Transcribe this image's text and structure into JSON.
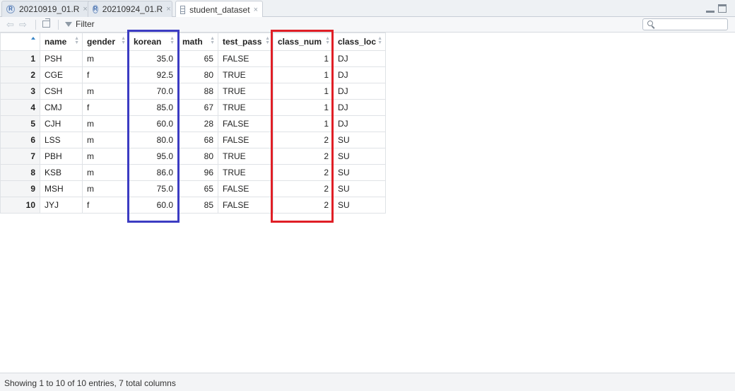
{
  "tabs": [
    {
      "label": "20210919_01.R",
      "type": "r-script",
      "close": "×"
    },
    {
      "label": "20210924_01.R",
      "type": "r-script",
      "close": "×"
    },
    {
      "label": "student_dataset",
      "type": "data",
      "close": "×"
    }
  ],
  "toolbar": {
    "back": "⇦",
    "forward": "⇨",
    "filter_label": "Filter",
    "search_value": "",
    "search_placeholder": ""
  },
  "table": {
    "columns": [
      "name",
      "gender",
      "korean",
      "math",
      "test_pass",
      "class_num",
      "class_loc"
    ],
    "rows": [
      {
        "n": "1",
        "cells": [
          "PSH",
          "m",
          "35.0",
          "65",
          "FALSE",
          "1",
          "DJ"
        ]
      },
      {
        "n": "2",
        "cells": [
          "CGE",
          "f",
          "92.5",
          "80",
          "TRUE",
          "1",
          "DJ"
        ]
      },
      {
        "n": "3",
        "cells": [
          "CSH",
          "m",
          "70.0",
          "88",
          "TRUE",
          "1",
          "DJ"
        ]
      },
      {
        "n": "4",
        "cells": [
          "CMJ",
          "f",
          "85.0",
          "67",
          "TRUE",
          "1",
          "DJ"
        ]
      },
      {
        "n": "5",
        "cells": [
          "CJH",
          "m",
          "60.0",
          "28",
          "FALSE",
          "1",
          "DJ"
        ]
      },
      {
        "n": "6",
        "cells": [
          "LSS",
          "m",
          "80.0",
          "68",
          "FALSE",
          "2",
          "SU"
        ]
      },
      {
        "n": "7",
        "cells": [
          "PBH",
          "m",
          "95.0",
          "80",
          "TRUE",
          "2",
          "SU"
        ]
      },
      {
        "n": "8",
        "cells": [
          "KSB",
          "m",
          "86.0",
          "96",
          "TRUE",
          "2",
          "SU"
        ]
      },
      {
        "n": "9",
        "cells": [
          "MSH",
          "m",
          "75.0",
          "65",
          "FALSE",
          "2",
          "SU"
        ]
      },
      {
        "n": "10",
        "cells": [
          "JYJ",
          "f",
          "60.0",
          "85",
          "FALSE",
          "2",
          "SU"
        ]
      }
    ]
  },
  "highlights": {
    "korean_color": "#3c3cc2",
    "class_num_color": "#e01f26"
  },
  "status": "Showing 1 to 10 of 10 entries, 7 total columns"
}
